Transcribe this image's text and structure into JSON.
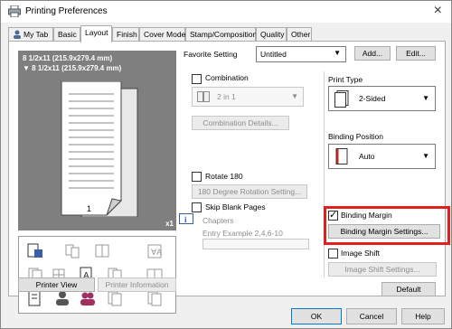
{
  "window": {
    "title": "Printing Preferences",
    "close_label": "×"
  },
  "tabs": [
    {
      "label": "My Tab",
      "active": false
    },
    {
      "label": "Basic",
      "active": false
    },
    {
      "label": "Layout",
      "active": true
    },
    {
      "label": "Finish",
      "active": false
    },
    {
      "label": "Cover Mode",
      "active": false
    },
    {
      "label": "Stamp/Composition",
      "active": false
    },
    {
      "label": "Quality",
      "active": false
    },
    {
      "label": "Other",
      "active": false
    }
  ],
  "preview": {
    "paper_size_1": "8 1/2x11 (215.9x279.4 mm)",
    "paper_size_2": "8 1/2x11 (215.9x279.4 mm)",
    "copies_label": "x1",
    "page_number": "1"
  },
  "left_buttons": {
    "printer_view": "Printer View",
    "printer_information": "Printer Information"
  },
  "favorite": {
    "label": "Favorite Setting",
    "value": "Untitled",
    "add_label": "Add...",
    "edit_label": "Edit..."
  },
  "combination": {
    "label": "Combination",
    "checked": false,
    "value": "2 in 1",
    "details_label": "Combination Details..."
  },
  "rotate": {
    "label": "Rotate 180",
    "checked": false,
    "settings_label": "180 Degree Rotation Setting..."
  },
  "skip_blank": {
    "label": "Skip Blank Pages",
    "checked": false
  },
  "chapters": {
    "label": "Chapters",
    "placeholder": "Entry Example 2,4,6-10"
  },
  "print_type": {
    "label": "Print Type",
    "value": "2-Sided"
  },
  "binding_position": {
    "label": "Binding Position",
    "value": "Auto"
  },
  "binding_margin": {
    "label": "Binding Margin",
    "checked": true,
    "settings_label": "Binding Margin Settings..."
  },
  "image_shift": {
    "label": "Image Shift",
    "checked": false,
    "settings_label": "Image Shift Settings..."
  },
  "default_label": "Default",
  "footer": {
    "ok": "OK",
    "cancel": "Cancel",
    "help": "Help"
  },
  "colors": {
    "highlight": "#e0201c",
    "preview_bg": "#7f7f7f"
  }
}
